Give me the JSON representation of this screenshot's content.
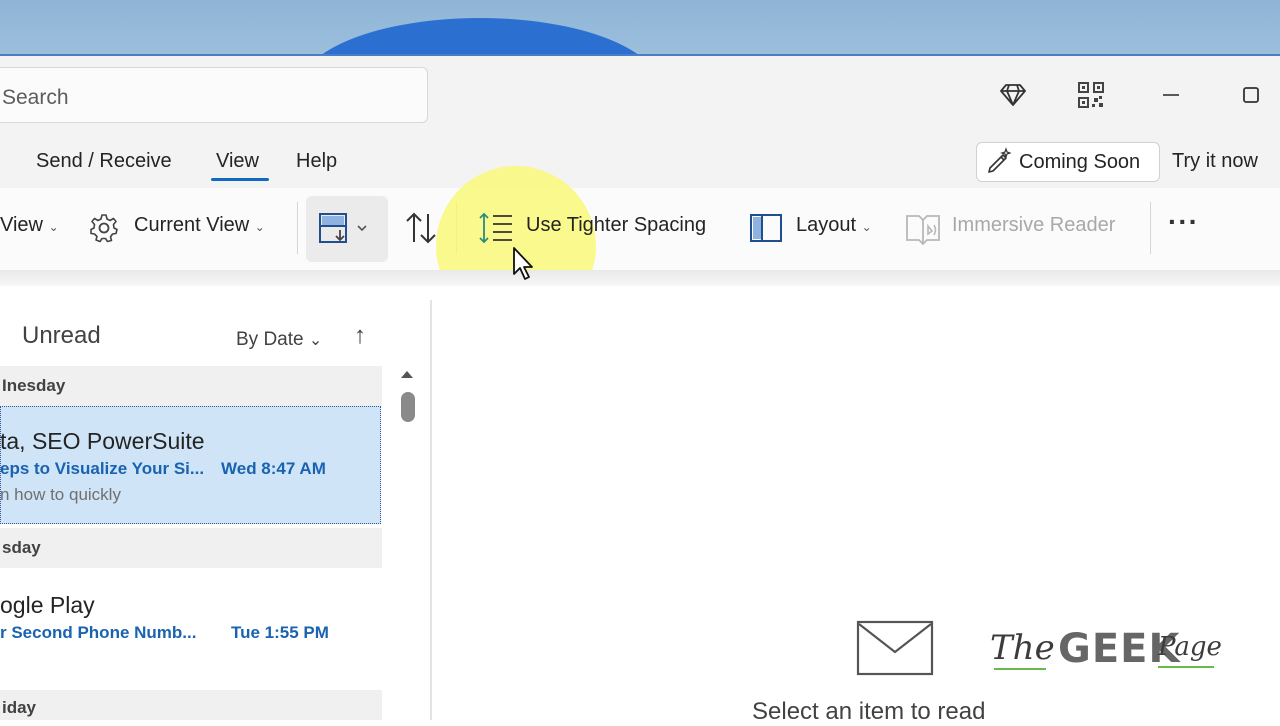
{
  "titlebar": {
    "search_placeholder": "Search",
    "premium_icon": "diamond-icon",
    "qr_icon": "qr-code-icon",
    "minimize_icon": "minimize-icon",
    "maximize_icon": "maximize-icon"
  },
  "tabs": {
    "items": [
      {
        "label": "Send / Receive"
      },
      {
        "label": "View",
        "active": true
      },
      {
        "label": "Help"
      }
    ],
    "coming_soon_label": "Coming Soon",
    "try_it_now_label": "Try it now"
  },
  "ribbon": {
    "change_view_label": "View",
    "current_view_label": "Current View",
    "message_preview_icon": "message-preview-icon",
    "sort_icon": "sort-arrows-icon",
    "tighter_spacing_label": "Use Tighter Spacing",
    "layout_label": "Layout",
    "immersive_reader_label": "Immersive Reader",
    "more_label": "···"
  },
  "message_list": {
    "filter_label": "Unread",
    "sort_label": "By Date",
    "sort_direction": "↑",
    "groups": [
      {
        "header": "Inesday",
        "messages": [
          {
            "sender": "ta, SEO PowerSuite",
            "subject": "eps to Visualize Your Si...",
            "time": "Wed 8:47 AM",
            "preview": "n how to quickly",
            "selected": true
          }
        ]
      },
      {
        "header": "sday",
        "messages": [
          {
            "sender": "ogle Play",
            "subject": "r Second Phone Numb...",
            "time": "Tue 1:55 PM",
            "preview": ""
          }
        ]
      },
      {
        "header": "iday",
        "messages": []
      }
    ]
  },
  "reading_pane": {
    "empty_icon": "envelope-icon",
    "empty_text": "Select an item to read"
  },
  "watermark": {
    "the": "The",
    "geek": "GEEK",
    "page": "Page"
  },
  "colors": {
    "accent": "#0f6cbd",
    "selected_row": "#cfe4f7",
    "unread_subject": "#1a63b0",
    "cursor_highlight": "#faf86e"
  }
}
